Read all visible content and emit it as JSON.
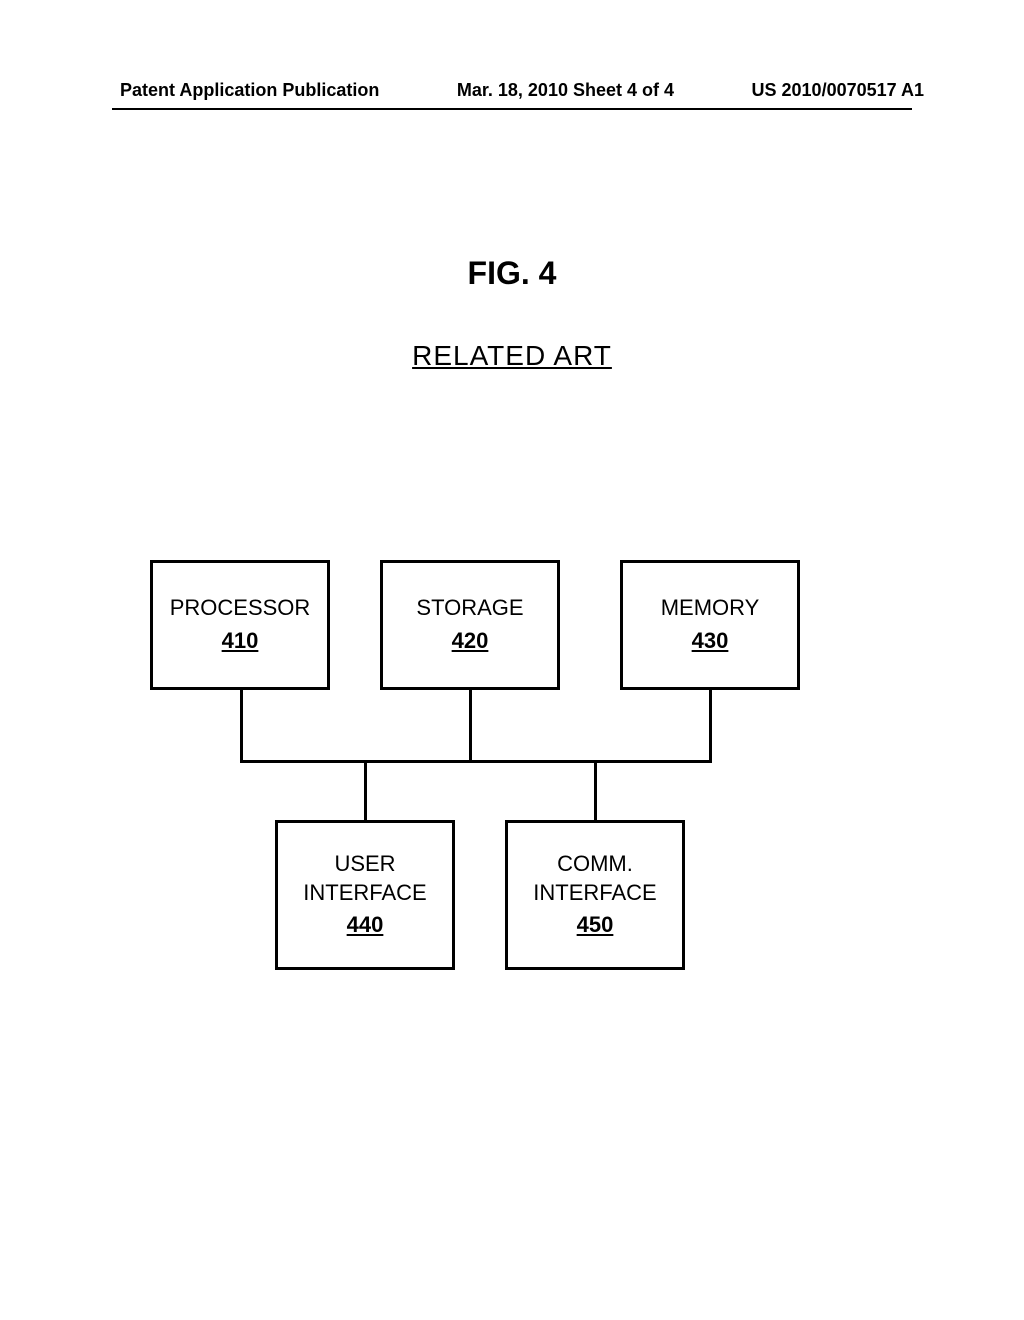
{
  "header": {
    "left": "Patent Application Publication",
    "center": "Mar. 18, 2010  Sheet 4 of 4",
    "right": "US 2010/0070517 A1"
  },
  "figure": {
    "title": "FIG. 4",
    "subtitle": "RELATED ART"
  },
  "blocks": {
    "processor": {
      "label": "PROCESSOR",
      "ref": "410"
    },
    "storage": {
      "label": "STORAGE",
      "ref": "420"
    },
    "memory": {
      "label": "MEMORY",
      "ref": "430"
    },
    "ui": {
      "label1": "USER",
      "label2": "INTERFACE",
      "ref": "440"
    },
    "comm": {
      "label1": "COMM.",
      "label2": "INTERFACE",
      "ref": "450"
    }
  }
}
